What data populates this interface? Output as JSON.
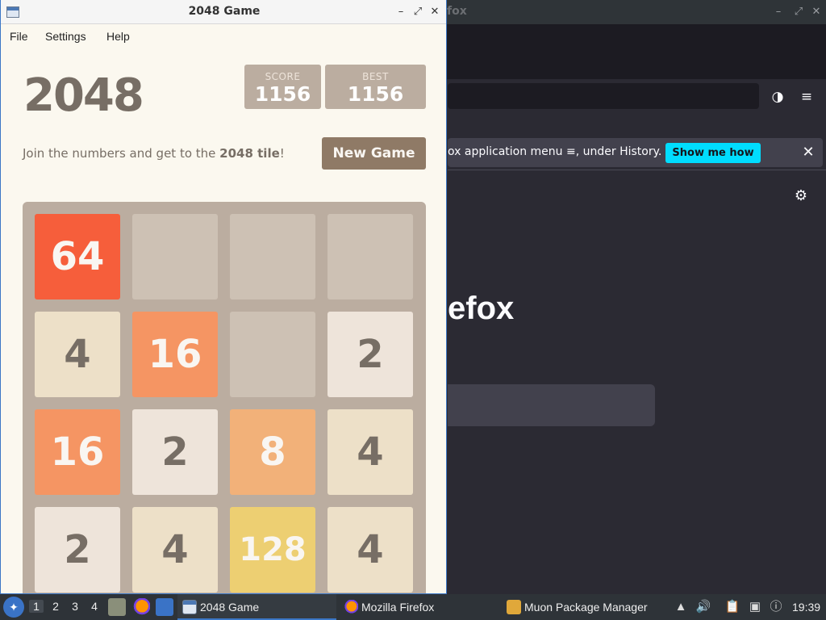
{
  "firefox": {
    "title_fragment": "fox",
    "window_controls": [
      "–",
      "⤢",
      "✕"
    ],
    "nav_icons": [
      "contrast-icon",
      "hamburger-menu-icon"
    ],
    "notice": {
      "text": "ox application menu ≡, under History.",
      "button": "Show me how",
      "close": "✕"
    },
    "settings_icon": "⚙",
    "wordmark_fragment": "efox"
  },
  "game_window": {
    "title": "2048 Game",
    "controls": [
      "–",
      "⤢",
      "✕"
    ],
    "menu": [
      "File",
      "Settings",
      "Help"
    ]
  },
  "game": {
    "logo": "2048",
    "score_label": "SCORE",
    "score": "1156",
    "best_label": "BEST",
    "best": "1156",
    "intro_prefix": "Join the numbers and get to the ",
    "intro_bold": "2048 tile",
    "intro_suffix": "!",
    "new_game": "New Game",
    "grid": [
      [
        "64",
        "",
        "",
        ""
      ],
      [
        "4",
        "16",
        "",
        "2"
      ],
      [
        "16",
        "2",
        "8",
        "4"
      ],
      [
        "2",
        "4",
        "128",
        "4"
      ]
    ],
    "tile_colors": {
      "empty": "#cdc1b4",
      "2": "#eee4da",
      "4": "#ede0c8",
      "8": "#f2b179",
      "16": "#f59563",
      "64": "#f65e3b",
      "128": "#edcf72"
    }
  },
  "taskbar": {
    "workspaces": [
      "1",
      "2",
      "3",
      "4"
    ],
    "tasks": [
      {
        "label": "2048 Game",
        "active": true
      },
      {
        "label": "Mozilla Firefox",
        "active": false
      },
      {
        "label": "Muon Package Manager",
        "active": false
      }
    ],
    "clock": "19:39"
  }
}
